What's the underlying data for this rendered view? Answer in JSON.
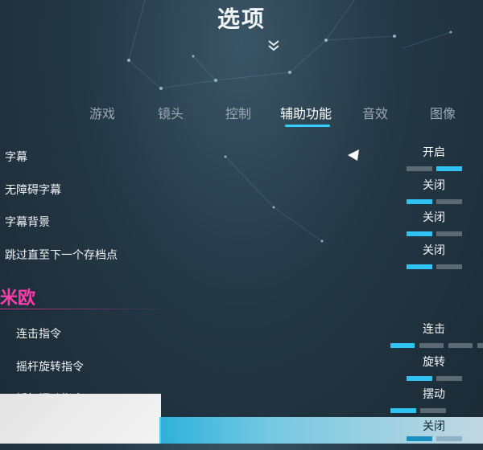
{
  "header": {
    "title": "选项"
  },
  "tabs": [
    {
      "label": "游戏",
      "active": false
    },
    {
      "label": "镜头",
      "active": false
    },
    {
      "label": "控制",
      "active": false
    },
    {
      "label": "辅助功能",
      "active": true
    },
    {
      "label": "音效",
      "active": false
    },
    {
      "label": "图像",
      "active": false
    }
  ],
  "settings": [
    {
      "label": "字幕",
      "value": "开启",
      "segments": 2,
      "selected_index": 1
    },
    {
      "label": "无障碍字幕",
      "value": "关闭",
      "segments": 2,
      "selected_index": 0
    },
    {
      "label": "字幕背景",
      "value": "关闭",
      "segments": 2,
      "selected_index": 0
    },
    {
      "label": "跳过直至下一个存档点",
      "value": "关闭",
      "segments": 2,
      "selected_index": 0
    }
  ],
  "section": {
    "title": "米欧"
  },
  "character_settings": [
    {
      "label": "连击指令",
      "value": "连击",
      "segments": 4,
      "selected_index": 0
    },
    {
      "label": "摇杆旋转指令",
      "value": "旋转",
      "segments": 2,
      "selected_index": 0
    },
    {
      "label": "摇杆摆动指令",
      "value": "摆动",
      "segments": 2,
      "selected_index": 0
    },
    {
      "label": "",
      "value": "关闭",
      "segments": 2,
      "selected_index": 0
    }
  ],
  "colors": {
    "accent": "#2fc2f2",
    "section": "#ff3dac",
    "inactive_segment": "#5c6a73"
  },
  "icons": {
    "collapse": "double-chevron-down-icon",
    "cursor": "triangle-cursor-icon"
  }
}
